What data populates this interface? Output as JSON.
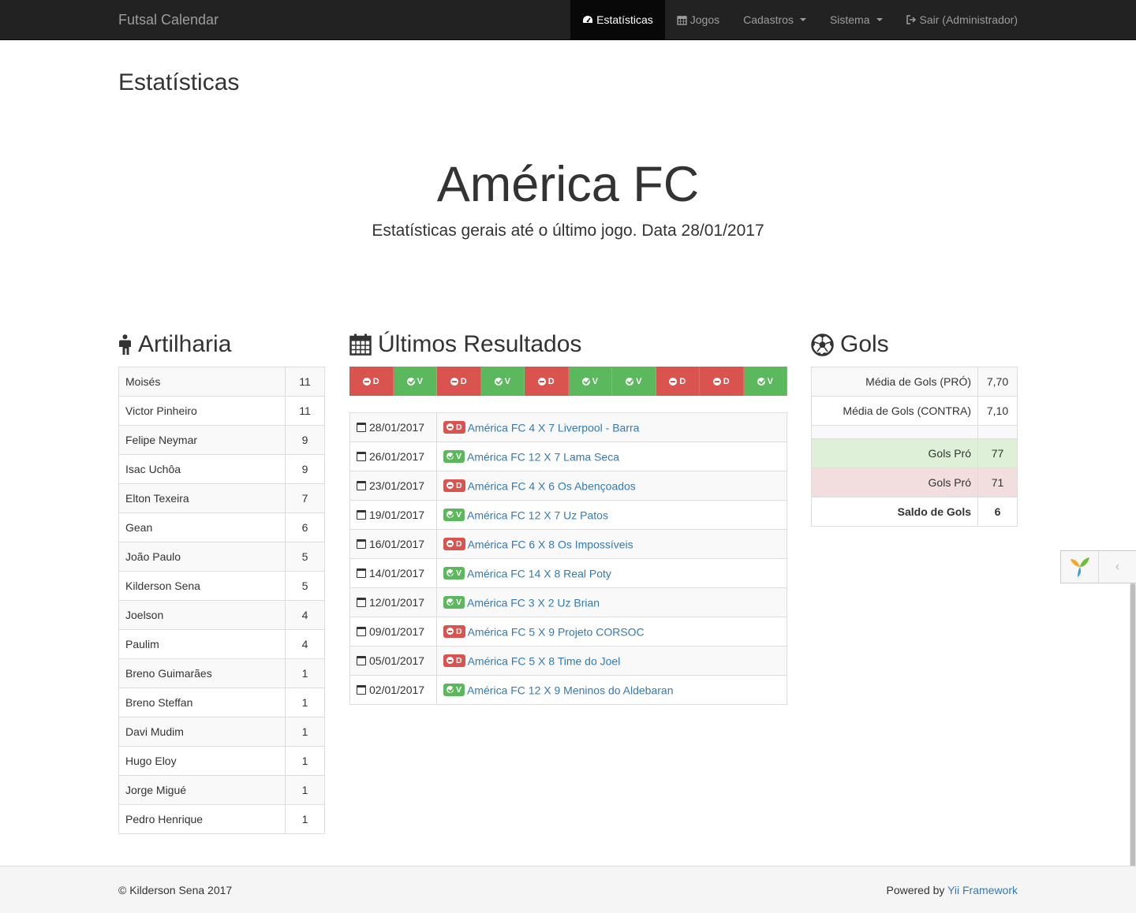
{
  "navbar": {
    "brand": "Futsal Calendar",
    "items": [
      {
        "label": "Estatísticas",
        "icon": "dashboard-icon",
        "active": true
      },
      {
        "label": "Jogos",
        "icon": "calendar-icon"
      },
      {
        "label": "Cadastros",
        "dropdown": true
      },
      {
        "label": "Sistema",
        "dropdown": true
      },
      {
        "label": "Sair (Administrador)",
        "icon": "logout-icon"
      }
    ]
  },
  "page_title": "Estatísticas",
  "jumbotron": {
    "title": "América FC",
    "subtitle": "Estatísticas gerais até o último jogo. Data 28/01/2017"
  },
  "artilharia": {
    "heading": "Artilharia",
    "rows": [
      {
        "name": "Moisés",
        "goals": "11"
      },
      {
        "name": "Victor Pinheiro",
        "goals": "11"
      },
      {
        "name": "Felipe Neymar",
        "goals": "9"
      },
      {
        "name": "Isac Uchôa",
        "goals": "9"
      },
      {
        "name": "Elton Texeira",
        "goals": "7"
      },
      {
        "name": "Gean",
        "goals": "6"
      },
      {
        "name": "João Paulo",
        "goals": "5"
      },
      {
        "name": "Kilderson Sena",
        "goals": "5"
      },
      {
        "name": "Joelson",
        "goals": "4"
      },
      {
        "name": "Paulim",
        "goals": "4"
      },
      {
        "name": "Breno Guimarães",
        "goals": "1"
      },
      {
        "name": "Breno Steffan",
        "goals": "1"
      },
      {
        "name": "Davi Mudim",
        "goals": "1"
      },
      {
        "name": "Hugo Eloy",
        "goals": "1"
      },
      {
        "name": "Jorge Migué",
        "goals": "1"
      },
      {
        "name": "Pedro Henrique",
        "goals": "1"
      }
    ]
  },
  "resultados": {
    "heading": "Últimos Resultados",
    "strip": [
      "D",
      "V",
      "D",
      "V",
      "D",
      "V",
      "V",
      "D",
      "D",
      "V"
    ],
    "rows": [
      {
        "date": "28/01/2017",
        "result": "D",
        "text": "América FC 4 X 7 Liverpool - Barra"
      },
      {
        "date": "26/01/2017",
        "result": "V",
        "text": "América FC 12 X 7 Lama Seca"
      },
      {
        "date": "23/01/2017",
        "result": "D",
        "text": "América FC 4 X 6 Os Abençoados"
      },
      {
        "date": "19/01/2017",
        "result": "V",
        "text": "América FC 12 X 7 Uz Patos"
      },
      {
        "date": "16/01/2017",
        "result": "D",
        "text": "América FC 6 X 8 Os Impossíveis"
      },
      {
        "date": "14/01/2017",
        "result": "V",
        "text": "América FC 14 X 8 Real Poty"
      },
      {
        "date": "12/01/2017",
        "result": "V",
        "text": "América FC 3 X 2 Uz Brian"
      },
      {
        "date": "09/01/2017",
        "result": "D",
        "text": "América FC 5 X 9 Projeto CORSOC"
      },
      {
        "date": "05/01/2017",
        "result": "D",
        "text": "América FC 5 X 8 Time do Joel"
      },
      {
        "date": "02/01/2017",
        "result": "V",
        "text": "América FC 12 X 9 Meninos do Aldebaran"
      }
    ]
  },
  "gols": {
    "heading": "Gols",
    "media_pro_label": "Média de Gols (PRÓ)",
    "media_pro": "7,70",
    "media_contra_label": "Média de Gols (CONTRA)",
    "media_contra": "7,10",
    "gols_pro_label": "Gols Pró",
    "gols_pro": "77",
    "gols_contra_label": "Gols Pró",
    "gols_contra": "71",
    "saldo_label": "Saldo de Gols",
    "saldo": "6"
  },
  "footer": {
    "copyright": "© Kilderson Sena 2017",
    "powered_prefix": "Powered by",
    "powered_link": "Yii Framework"
  },
  "colors": {
    "win": "#5cb85c",
    "loss": "#d9534f",
    "link": "#337ab7",
    "navbar": "#222222"
  }
}
